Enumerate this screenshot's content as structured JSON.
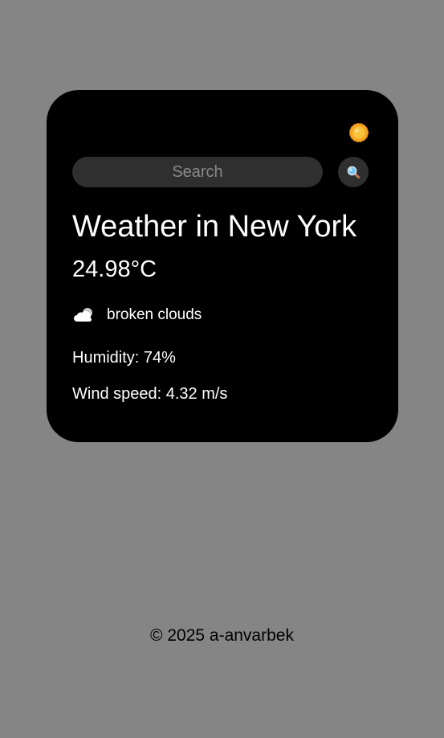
{
  "theme": {
    "toggle_icon": "sun-icon",
    "page_background": "#858585",
    "card_background": "#000000",
    "input_background": "#2f2f2f",
    "text_color": "#ffffff"
  },
  "search": {
    "placeholder": "Search",
    "value": "",
    "button_icon": "magnifier-icon"
  },
  "weather": {
    "city_heading": "Weather in New York",
    "temperature": "24.98°C",
    "icon": "broken-clouds-icon",
    "description": "broken clouds",
    "humidity": "Humidity: 74%",
    "wind_speed": "Wind speed: 4.32 m/s"
  },
  "footer": {
    "copyright": "© 2025 a-anvarbek"
  }
}
